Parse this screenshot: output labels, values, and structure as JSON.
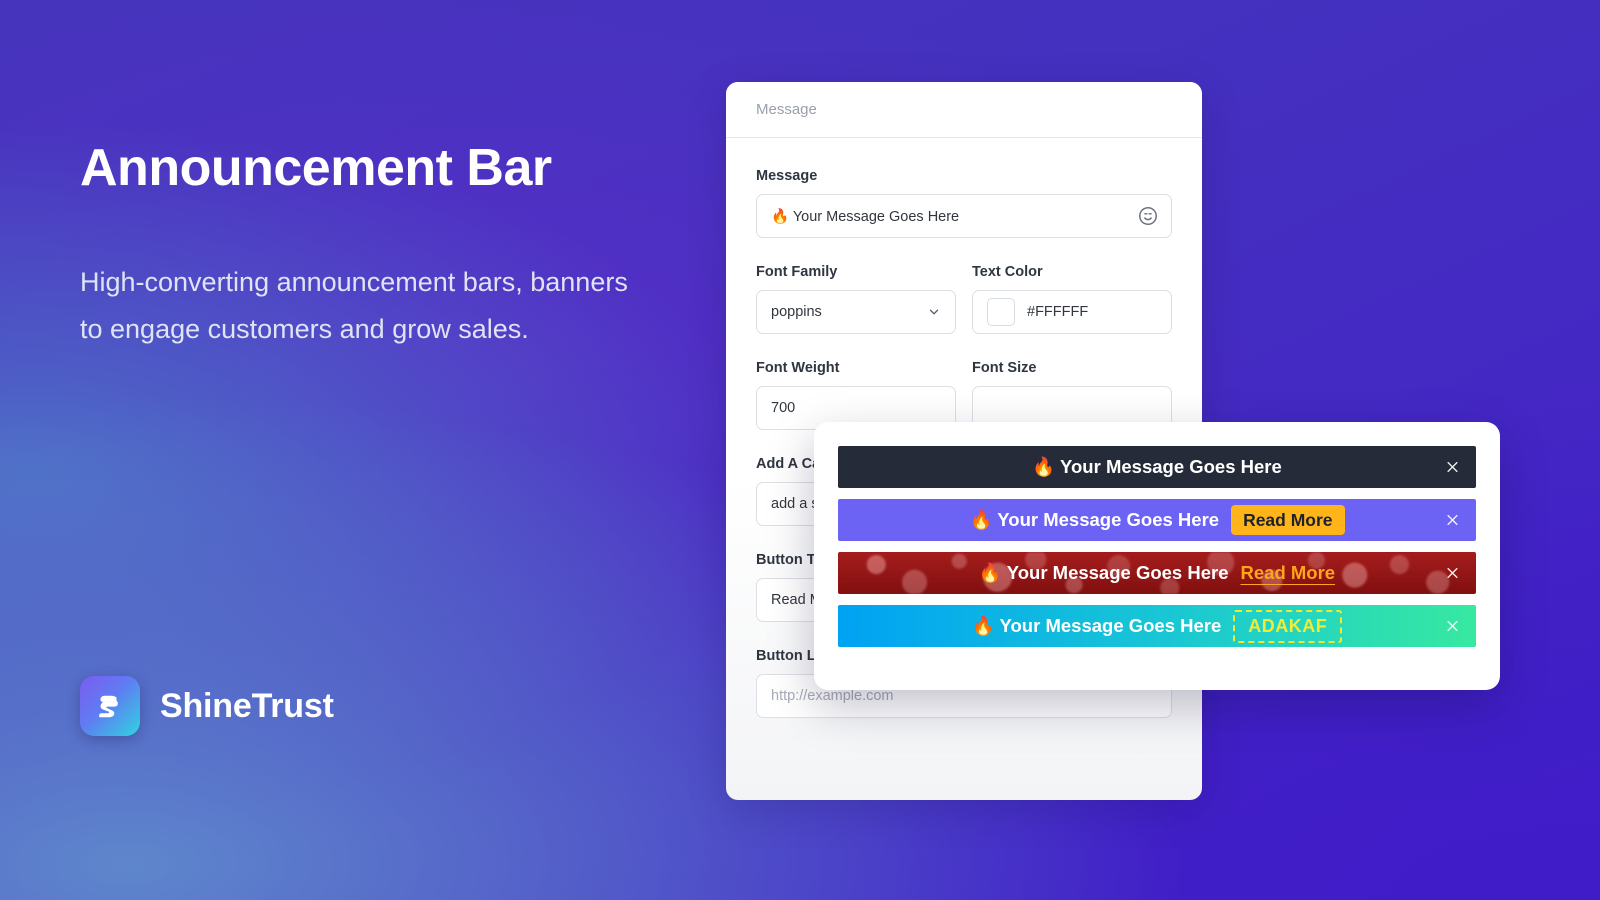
{
  "hero": {
    "title": "Announcement Bar",
    "subtitle": "High-converting announcement bars, banners to engage customers and grow sales."
  },
  "brand": {
    "name": "ShineTrust",
    "mark_icon": "shinetrust-s-logo-icon",
    "gradient_from": "#7b5cf0",
    "gradient_to": "#2fd4e0"
  },
  "form": {
    "tab_label": "Message",
    "fields": {
      "message": {
        "label": "Message",
        "value": "🔥 Your Message Goes Here",
        "emoji_icon": "emoji-smiley-icon"
      },
      "font_family": {
        "label": "Font Family",
        "value": "poppins",
        "chevron_icon": "chevron-down-icon"
      },
      "text_color": {
        "label": "Text Color",
        "value": "#FFFFFF",
        "swatch": "#FFFFFF"
      },
      "font_weight": {
        "label": "Font Weight",
        "value": "700"
      },
      "font_size": {
        "label": "Font Size",
        "value": ""
      },
      "add_a_campaign": {
        "label": "Add A Campaign",
        "value": "add a shop"
      },
      "button_text": {
        "label": "Button Text",
        "value": "Read More"
      },
      "button_link_url": {
        "label": "Button Link URL",
        "placeholder": "http://example.com",
        "value": ""
      }
    }
  },
  "preview": {
    "close_icon": "close-x-icon",
    "bars": [
      {
        "style": "dark",
        "text": "🔥 Your Message Goes Here",
        "bg": "#252b38",
        "text_color": "#FFFFFF",
        "cta": null
      },
      {
        "style": "purple",
        "text": "🔥 Your Message Goes Here",
        "bg": "#6c63f5",
        "text_color": "#FFFFFF",
        "cta": {
          "kind": "button",
          "label": "Read More",
          "bg": "#ffb51a",
          "color": "#1e222b"
        }
      },
      {
        "style": "red-bokeh",
        "text": "🔥 Your Message Goes Here",
        "bg": "#9d1313",
        "text_color": "#FFFFFF",
        "cta": {
          "kind": "link",
          "label": "Read More",
          "color": "#ffa41b"
        }
      },
      {
        "style": "cyan-green-gradient",
        "text": "🔥 Your Message Goes Here",
        "bg_from": "#00a2f3",
        "bg_to": "#37e9a0",
        "text_color": "#FFFFFF",
        "cta": {
          "kind": "coupon",
          "label": "ADAKAF",
          "color": "#f2ec35"
        }
      }
    ]
  }
}
